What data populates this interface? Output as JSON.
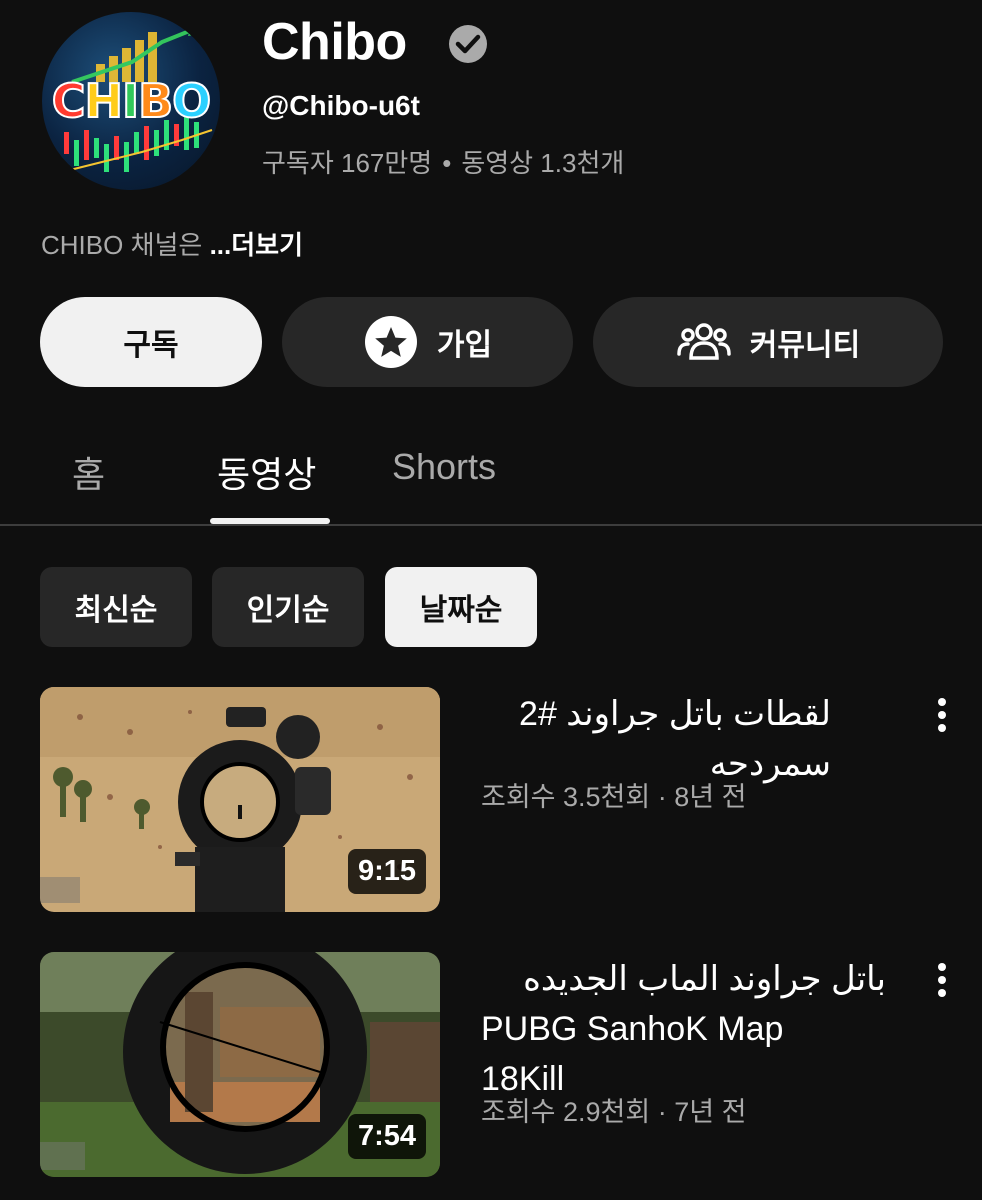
{
  "channel": {
    "name": "Chibo",
    "handle": "@Chibo-u6t",
    "subscribers": "구독자 167만명",
    "separator": "•",
    "video_count": "동영상 1.3천개",
    "description": "CHIBO 채널은",
    "more_label": "...더보기",
    "avatar_letters": [
      "C",
      "H",
      "I",
      "B",
      "O"
    ],
    "verified_icon": "verified-check-icon"
  },
  "actions": {
    "subscribe_label": "구독",
    "join_label": "가입",
    "join_icon": "star-icon",
    "community_label": "커뮤니티",
    "community_icon": "people-icon"
  },
  "tabs": [
    {
      "label": "홈",
      "active": false
    },
    {
      "label": "동영상",
      "active": true
    },
    {
      "label": "Shorts",
      "active": false
    }
  ],
  "sort_chips": [
    {
      "label": "최신순",
      "selected": false
    },
    {
      "label": "인기순",
      "selected": false
    },
    {
      "label": "날짜순",
      "selected": true
    }
  ],
  "videos": [
    {
      "title": "لقطات باتل جراوند #2 سمردحه",
      "meta": "조회수 3.5천회 · 8년 전",
      "duration": "9:15"
    },
    {
      "title_line1": "باتل جراوند الماب الجديده",
      "title_line2": "PUBG  SanhoK Map",
      "title_line3": "18Kill",
      "meta": "조회수 2.9천회 · 7년 전",
      "duration": "7:54"
    }
  ],
  "colors": {
    "background": "#0f0f0f",
    "surface": "#272727",
    "primary_text": "#f1f1f1",
    "secondary_text": "#aaaaaa"
  }
}
